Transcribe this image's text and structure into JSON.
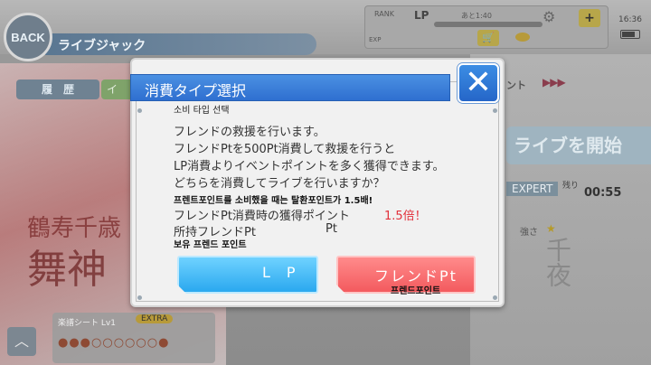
{
  "header": {
    "back_label": "BACK",
    "screen_title": "ライブジャック",
    "rank_label": "RANK",
    "lp_label": "LP",
    "lp_remaining": "あと1:40",
    "exp_label": "EXP",
    "plus_symbol": "+",
    "clock": "16:36"
  },
  "background": {
    "tab_history": "履　歴",
    "tab_other": "イ",
    "event_label": "ント",
    "event_arrows": "▶▶▶",
    "start_live": "ライブを開始",
    "difficulty": "EXPERT",
    "remaining_label": "残り",
    "remaining_time": "00:55",
    "strength_label": "強さ",
    "song_small": "鶴寿千歳",
    "song_large": "舞神",
    "deco_kanji": "千夜",
    "sheet_label": "楽譜シート Lv1",
    "sheet_badge": "EXTRA",
    "drops": "●●●○○○○○○●"
  },
  "dialog": {
    "title": "消費タイプ選択",
    "subtitle_ko": "소비 타입 선택",
    "close_symbol": "✕",
    "line1": "フレンドの救援を行います。",
    "line2": "フレンドPtを500Pt消費して救援を行うと",
    "line3": "LP消費よりイベントポイントを多く獲得できます。",
    "line4": "どちらを消費してライブを行いますか？",
    "line_ko1": "프렌트포인트를 소비했을 때는 탈환포인트가 1.5배!",
    "line5": "フレンドPt消費時の獲得ポイント",
    "bonus": "1.5倍！",
    "line6": "所持フレンドPt",
    "pt_unit": "Pt",
    "line_ko2": "보유 프렌드 포인트",
    "lp_button": "LP",
    "friend_button": "フレンドPt",
    "friend_button_ko": "프렌드포인트"
  }
}
